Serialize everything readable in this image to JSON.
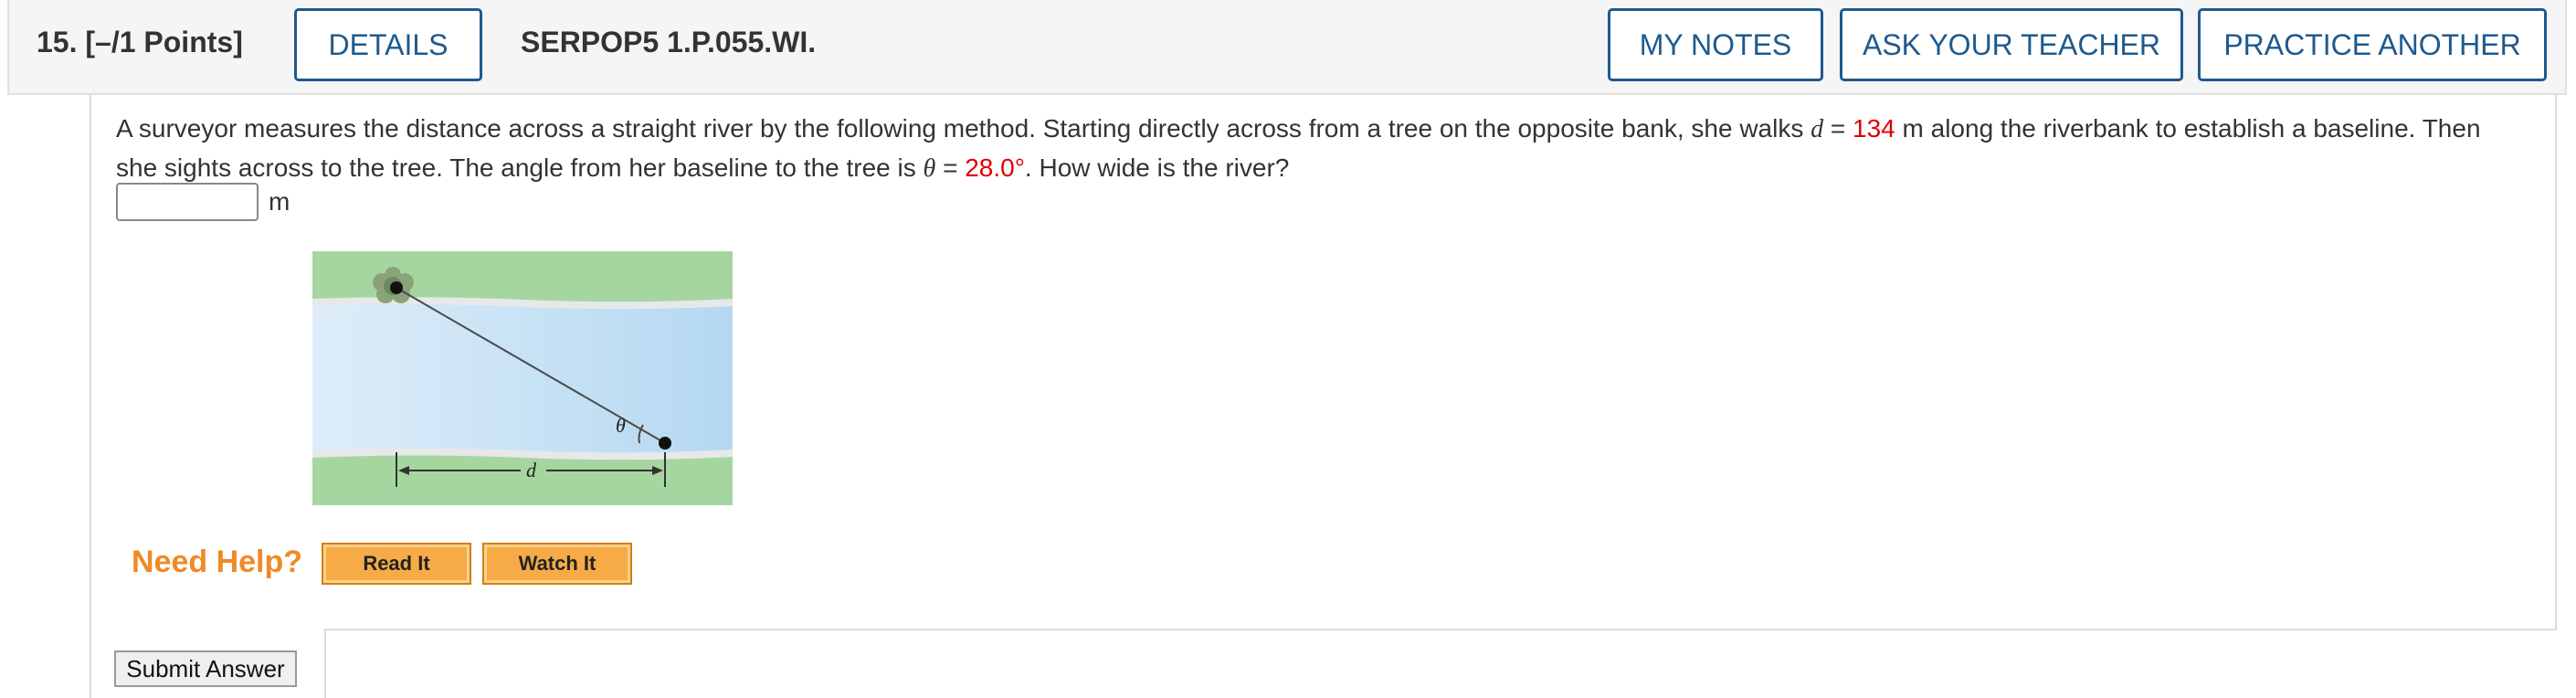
{
  "header": {
    "question_label": "15.  [–/1 Points]",
    "details_label": "DETAILS",
    "problem_code": "SERPOP5 1.P.055.WI.",
    "my_notes_label": "MY NOTES",
    "ask_teacher_label": "ASK YOUR TEACHER",
    "practice_another_label": "PRACTICE ANOTHER"
  },
  "question": {
    "part1": "A surveyor measures the distance across a straight river by the following method. Starting directly across from a tree on the opposite bank, she walks ",
    "var_d": "d",
    "eq1": " = ",
    "d_value": "134",
    "part2": " m along the riverbank to establish a baseline. Then she sights across to the tree. The angle from her baseline to the tree is ",
    "var_theta": "θ",
    "eq2": " = ",
    "theta_value": "28.0°",
    "part3": ". How wide is the river?",
    "answer_value": "",
    "unit": "m"
  },
  "figure": {
    "theta_label": "θ",
    "d_label": "d",
    "colors": {
      "grass": "#a6d6a0",
      "water": "#bcdcf2",
      "bank": "#e6e8ea"
    }
  },
  "help": {
    "need_help_label": "Need Help?",
    "read_it_label": "Read It",
    "watch_it_label": "Watch It"
  },
  "submit_label": "Submit Answer",
  "colors": {
    "accent": "#1e5a8e",
    "highlight": "#e00000",
    "help": "#f08a24"
  }
}
